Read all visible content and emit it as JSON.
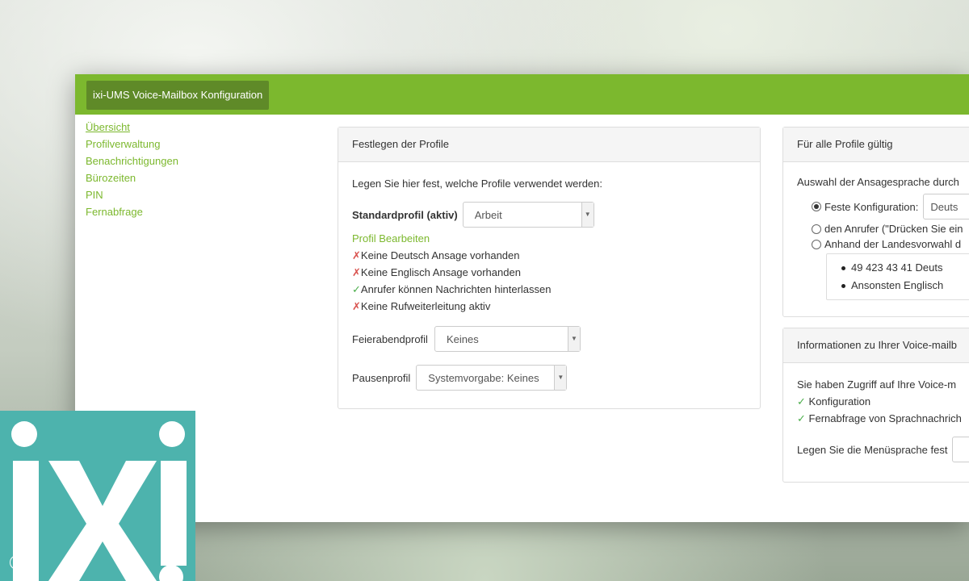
{
  "header": {
    "brand": "ixi-UMS Voice-Mailbox Konfiguration"
  },
  "sidebar": {
    "items": [
      {
        "label": "Übersicht",
        "active": true
      },
      {
        "label": "Profilverwaltung"
      },
      {
        "label": "Benachrichtigungen"
      },
      {
        "label": "Bürozeiten"
      },
      {
        "label": "PIN"
      },
      {
        "label": "Fernabfrage"
      }
    ]
  },
  "profiles": {
    "title": "Festlegen der Profile",
    "intro": "Legen Sie hier fest, welche Profile verwendet werden:",
    "standard_label": "Standardprofil (aktiv)",
    "standard_value": "Arbeit",
    "edit_link": "Profil Bearbeiten",
    "statuses": [
      {
        "mark": "✗",
        "text": "Keine Deutsch Ansage vorhanden",
        "ok": false
      },
      {
        "mark": "✗",
        "text": "Keine Englisch Ansage vorhanden",
        "ok": false
      },
      {
        "mark": "✓",
        "text": "Anrufer können Nachrichten hinterlassen",
        "ok": true
      },
      {
        "mark": "✗",
        "text": "Keine Rufweiterleitung aktiv",
        "ok": false
      }
    ],
    "feierabend_label": "Feierabendprofil",
    "feierabend_value": "Keines",
    "pausen_label": "Pausenprofil",
    "pausen_value": "Systemvorgabe: Keines"
  },
  "all_profiles": {
    "title": "Für alle Profile gültig",
    "lang_selection": "Auswahl der Ansagesprache durch",
    "opt_fixed": "Feste Konfiguration:",
    "opt_fixed_value": "Deuts",
    "opt_caller": "den Anrufer (\"Drücken Sie ein",
    "opt_country": "Anhand der Landesvorwahl d",
    "rules": [
      "49  423  43  41  Deuts",
      "Ansonsten Englisch"
    ]
  },
  "info": {
    "title": "Informationen zu Ihrer Voice-mailb",
    "access": "Sie haben Zugriff auf Ihre Voice-m",
    "items": [
      {
        "mark": "✓",
        "text": "Konfiguration"
      },
      {
        "mark": "✓",
        "text": "Fernabfrage von Sprachnachrich"
      }
    ],
    "menu_lang_label": "Legen Sie die Menüsprache fest"
  },
  "logo": {
    "text": "ixi",
    "copyright": "©"
  },
  "colors": {
    "brand_green": "#7cb82e",
    "logo_teal": "#4db3ad",
    "error_red": "#d9534f",
    "ok_green": "#4cae4c"
  }
}
